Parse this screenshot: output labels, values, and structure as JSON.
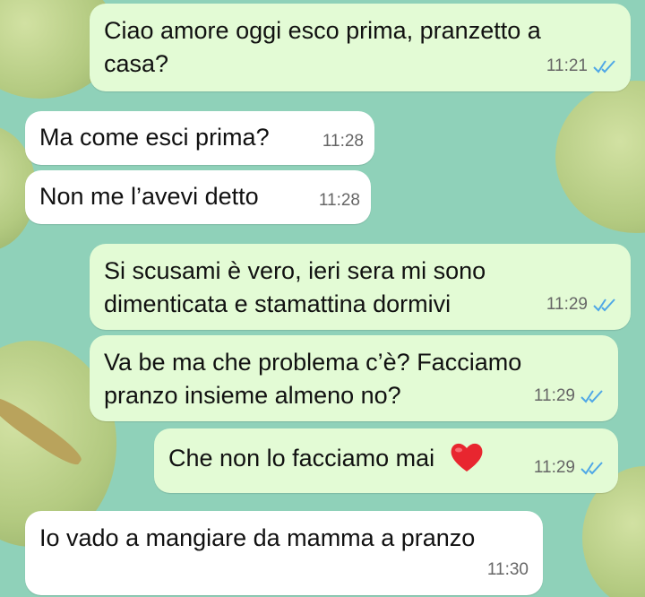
{
  "chat": {
    "messages": [
      {
        "text_lines": [
          "Ciao amore oggi esco prima, pranzetto a",
          "casa?"
        ],
        "time": "11:21",
        "direction": "out"
      },
      {
        "text_lines": [
          "Ma come esci prima?"
        ],
        "time": "11:28",
        "direction": "in"
      },
      {
        "text_lines": [
          "Non me l’avevi detto"
        ],
        "time": "11:28",
        "direction": "in"
      },
      {
        "text_lines": [
          "Si scusami è vero, ieri sera mi sono",
          "dimenticata e stamattina dormivi"
        ],
        "time": "11:29",
        "direction": "out"
      },
      {
        "text_lines": [
          "Va be ma che problema c’è? Facciamo",
          "pranzo insieme almeno no?"
        ],
        "time": "11:29",
        "direction": "out"
      },
      {
        "text_lines": [
          "Che non lo facciamo mai"
        ],
        "emoji": "heart-icon",
        "time": "11:29",
        "direction": "out"
      },
      {
        "text_lines": [
          "Io vado a mangiare da mamma a pranzo"
        ],
        "time": "11:30",
        "direction": "in"
      }
    ]
  },
  "colors": {
    "outgoing_bubble": "#e3fbd5",
    "incoming_bubble": "#ffffff",
    "read_ticks": "#4fa7e6",
    "wallpaper": "#8fd1b9"
  }
}
